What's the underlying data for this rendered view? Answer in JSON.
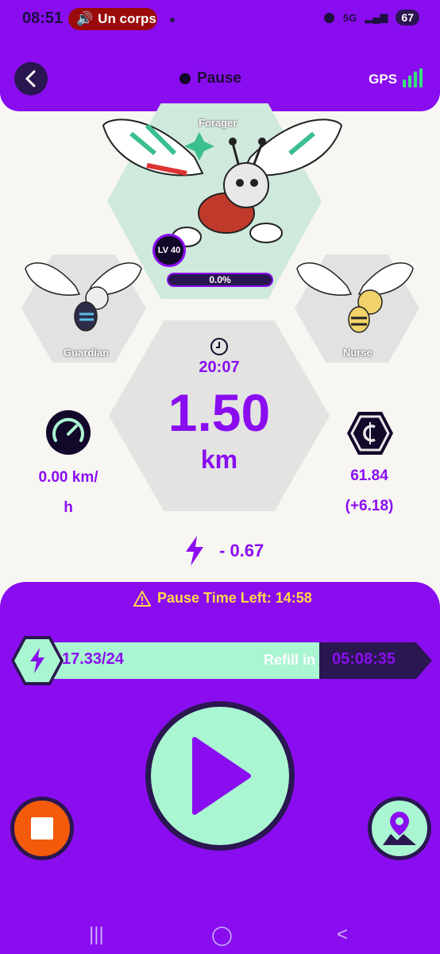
{
  "status_bar": {
    "time": "08:51",
    "media_label": "Un corps",
    "network": "5G",
    "battery": "67"
  },
  "header": {
    "status": "Pause",
    "gps_label": "GPS"
  },
  "bees": {
    "main": {
      "role": "Forager",
      "level": "LV 40",
      "progress": "0.0%"
    },
    "left": {
      "role": "Guardian"
    },
    "right": {
      "role": "Nurse"
    }
  },
  "stats": {
    "time": "20:07",
    "distance": "1.50",
    "distance_unit": "km",
    "speed_line1": "0.00 km/",
    "speed_line2": "h",
    "coins_line1": "61.84",
    "coins_line2": "(+6.18)",
    "energy": "- 0.67"
  },
  "panel": {
    "pause_left": "Pause Time Left: 14:58",
    "energy_count": "17.33/24",
    "refill_label": "Refill in",
    "refill_timer": "05:08:35",
    "energy_fill_fraction": 0.72
  },
  "colors": {
    "brand": "#8a0df0",
    "mint": "#aaf5d2",
    "dark": "#2a1650",
    "stop": "#f35a0a",
    "warning": "#ffd84a"
  },
  "icons": [
    "back-icon",
    "status-dot-icon",
    "gps-signal-icon",
    "clock-icon",
    "speedometer-icon",
    "coin-icon",
    "lightning-icon",
    "warning-icon",
    "play-icon",
    "stop-icon",
    "map-pin-icon"
  ]
}
